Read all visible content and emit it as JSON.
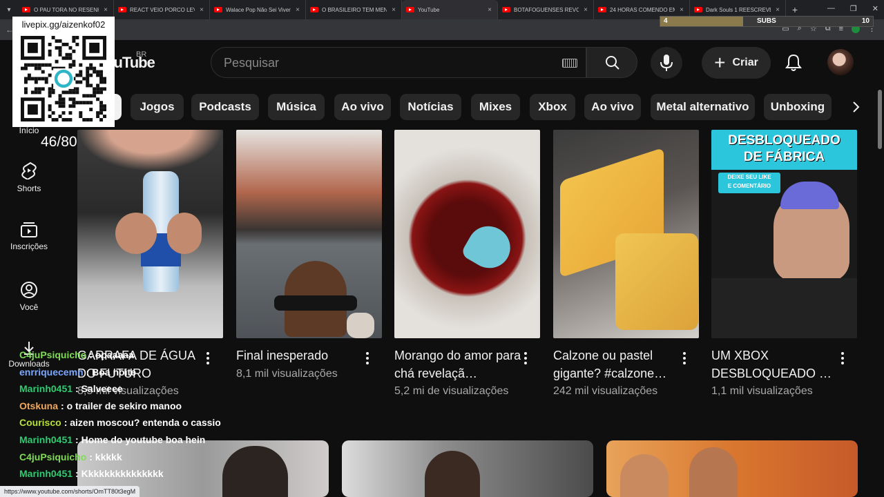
{
  "browser": {
    "tabs": [
      {
        "title": "O PAU TORA NO RESENHA"
      },
      {
        "title": "REACT VEIO PORCO LEVA"
      },
      {
        "title": "Walace Pop Não Sei Viver"
      },
      {
        "title": "O BRASILEIRO TEM MENOS"
      },
      {
        "title": "YouTube",
        "active": true
      },
      {
        "title": "BOTAFOGUENSES REVOLTA"
      },
      {
        "title": "24 HORAS COMENDO EM"
      },
      {
        "title": "Dark Souls 1 REESCREVE"
      }
    ],
    "status_url": "https://www.youtube.com/shorts/OmTT80t3egM"
  },
  "overlay": {
    "qr_label": "livepix.gg/aizenkof02",
    "counter": "46/80",
    "subs": {
      "label": "SUBS",
      "min": "4",
      "max": "10",
      "progress": 0.39
    }
  },
  "header": {
    "logo": "YouTube",
    "country": "BR",
    "search_placeholder": "Pesquisar",
    "create_label": "Criar"
  },
  "chips": [
    "Jogos",
    "Podcasts",
    "Música",
    "Ao vivo",
    "Notícias",
    "Mixes",
    "Xbox",
    "Ao vivo",
    "Metal alternativo",
    "Unboxing"
  ],
  "sidebar": {
    "items": [
      {
        "label": "Início",
        "icon": "home-icon"
      },
      {
        "label": "Shorts",
        "icon": "shorts-icon"
      },
      {
        "label": "Inscrições",
        "icon": "subscriptions-icon"
      },
      {
        "label": "Você",
        "icon": "you-icon"
      },
      {
        "label": "Downloads",
        "icon": "download-icon"
      }
    ]
  },
  "shorts": [
    {
      "title": "GARRAFA DE ÁGUA DO FUTURO",
      "views": "8,5 mil visualizações"
    },
    {
      "title": "Final inesperado",
      "views": "8,1 mil visualizações"
    },
    {
      "title": "Morango do amor para chá revelaçã…",
      "views": "5,2 mi de visualizações"
    },
    {
      "title": "Calzone ou pastel gigante? #calzone…",
      "views": "242 mil visualizações"
    },
    {
      "title": "UM XBOX DESBLOQUEADO …",
      "views": "1,1 mil visualizações",
      "thumb_text": [
        "DESBLOQUEADO",
        "DE FÁBRICA",
        "DEIXE SEU LIKE",
        "E COMENTÁRIO"
      ]
    }
  ],
  "chat": [
    {
      "user": "C4juPsiquicho",
      "msg": ": opaaaaa",
      "color": "#7fdc54"
    },
    {
      "user": "enrriquecemn",
      "msg": ": Boa noite",
      "color": "#7aa8ff"
    },
    {
      "user": "Marinh0451",
      "msg": ": Salveeee",
      "color": "#2ecc71"
    },
    {
      "user": "Otskuna",
      "msg": ": o trailer de sekiro manoo",
      "color": "#f0a85a"
    },
    {
      "user": "Courisco",
      "msg": ": aizen moscou? entenda o cassio",
      "color": "#b8e23a"
    },
    {
      "user": "Marinh0451",
      "msg": ": Home do youtube boa hein",
      "color": "#2ecc71"
    },
    {
      "user": "C4juPsiquicho",
      "msg": ": kkkkk",
      "color": "#7fdc54"
    },
    {
      "user": "Marinh0451",
      "msg": ": Kkkkkkkkkkkkkkk",
      "color": "#2ecc71"
    }
  ],
  "colors": {
    "background": "#0f0f0f",
    "chip": "#272727",
    "accent": "#ff0000",
    "muted_text": "#aaaaaa"
  }
}
